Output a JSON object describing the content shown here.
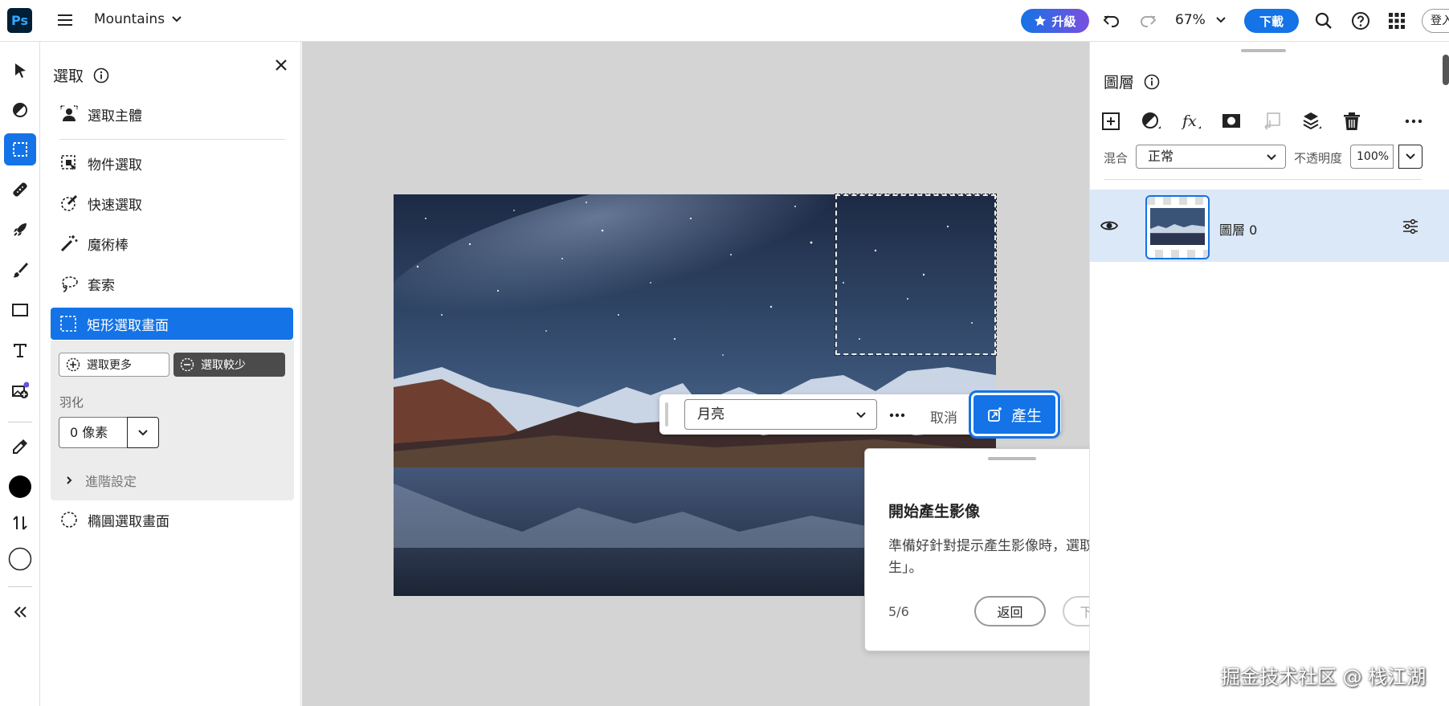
{
  "app": {
    "logo": "Ps",
    "doc_title": "Mountains"
  },
  "topbar": {
    "upgrade_label": "升級",
    "zoom": "67%",
    "download_label": "下載",
    "login_label": "登入"
  },
  "tools": [
    "move-tool",
    "adjust-tool",
    "selection-tool",
    "healing-tool",
    "quick-action-tool",
    "brush-tool",
    "shape-tool",
    "type-tool",
    "add-image-tool",
    "eyedropper-tool",
    "foreground-color",
    "swap-colors",
    "background-color",
    "collapse-toolbar"
  ],
  "selection_panel": {
    "title": "選取",
    "items": [
      {
        "label": "選取主體"
      },
      {
        "label": "物件選取"
      },
      {
        "label": "快速選取"
      },
      {
        "label": "魔術棒"
      },
      {
        "label": "套索"
      },
      {
        "label": "矩形選取畫面"
      },
      {
        "label": "橢圓選取畫面"
      }
    ],
    "mode_more": "選取更多",
    "mode_less": "選取較少",
    "feather_label": "羽化",
    "feather_value": "0 像素",
    "advanced_label": "進階設定"
  },
  "genfill": {
    "prompt_value": "月亮",
    "cancel_label": "取消",
    "generate_label": "產生"
  },
  "tour": {
    "title": "開始產生影像",
    "body": "準備好針對提示產生影像時，選取「產生」。",
    "step": "5/6",
    "back_label": "返回",
    "next_label": "下一個"
  },
  "layers_panel": {
    "title": "圖層",
    "blend_label": "混合",
    "blend_value": "正常",
    "opacity_label": "不透明度",
    "opacity_value": "100%",
    "layers": [
      {
        "name": "圖層 0"
      }
    ]
  },
  "watermark": "掘金技术社区 @ 栈江湖",
  "colors": {
    "accent": "#1473e6",
    "foreground": "#000000",
    "background": "#ffffff"
  }
}
